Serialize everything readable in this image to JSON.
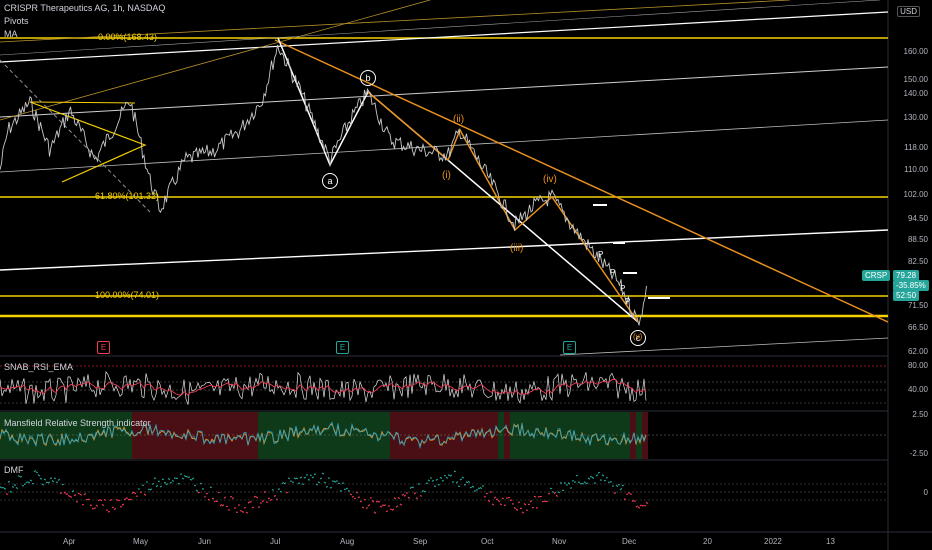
{
  "chart": {
    "title": "CRISPR Therapeutics AG, 1h, NASDAQ",
    "indicators": [
      "Pivots",
      "MA"
    ],
    "currency": "USD",
    "symbol_tag": "CRSP",
    "last_price": "79.28",
    "change_pct": "-35.85%",
    "countdown": "52:50"
  },
  "price_axis": [
    "160.00",
    "150.00",
    "140.00",
    "130.00",
    "118.00",
    "110.00",
    "102.00",
    "94.50",
    "88.50",
    "82.50",
    "71.50",
    "66.50",
    "62.00"
  ],
  "time_axis": [
    "Apr",
    "May",
    "Jun",
    "Jul",
    "Aug",
    "Sep",
    "Oct",
    "Nov",
    "Dec",
    "20",
    "2022",
    "13"
  ],
  "fib_levels": [
    {
      "label": "0.00%(168.43)"
    },
    {
      "label": "61.80%(101.32)"
    },
    {
      "label": "100.00%(74.01)"
    }
  ],
  "waves": {
    "a": "a",
    "b": "b",
    "c": "c",
    "i": "(i)",
    "ii": "(ii)",
    "iii": "(iii)",
    "iv": "(iv)",
    "v": "(v)"
  },
  "pivot_markers": [
    "P",
    "P",
    "P",
    "P"
  ],
  "earnings_badges": [
    "E",
    "E",
    "E"
  ],
  "panes": [
    {
      "name": "SNAB_RSI_EMA",
      "axis": [
        "80.00",
        "40.00"
      ]
    },
    {
      "name": "Mansfield Relative Strength indicator",
      "axis": [
        "2.50",
        "-2.50"
      ]
    },
    {
      "name": "DMF",
      "axis": [
        "0"
      ]
    }
  ],
  "colors": {
    "background": "#000000",
    "price": "#c8c8c8",
    "fib": "#f5d100",
    "trend_orange": "#e8901e",
    "channel_white": "#ffffff",
    "tag_green": "#26a69a",
    "dmf_green": "#26a69a",
    "dmf_red": "#ef3b55"
  },
  "chart_data": {
    "type": "line",
    "title": "CRISPR Therapeutics AG, 1h, NASDAQ",
    "x": [
      "Apr",
      "May",
      "Jun",
      "Jul",
      "Aug",
      "Sep",
      "Oct",
      "Nov",
      "Dec"
    ],
    "series": [
      {
        "values": [
          130,
          112,
          122,
          168,
          120,
          120,
          100,
          88,
          70
        ]
      }
    ],
    "ylim": [
      62,
      170
    ],
    "grid": false
  }
}
